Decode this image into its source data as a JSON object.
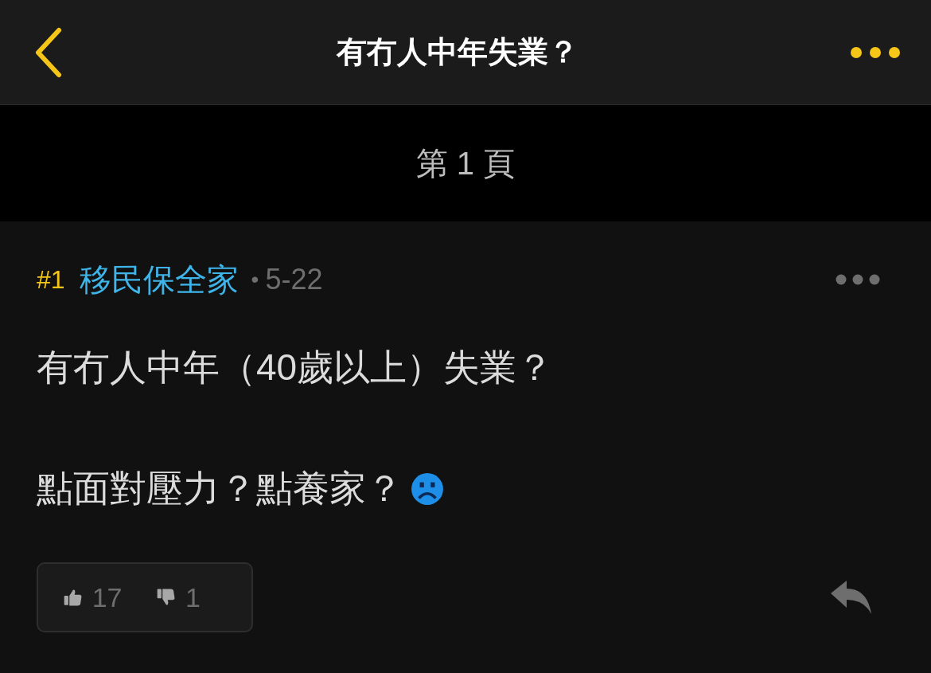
{
  "header": {
    "title": "有冇人中年失業？"
  },
  "page_label": "第 1 頁",
  "post": {
    "number": "#1",
    "author": "移民保全家",
    "separator": "•",
    "date": "5-22",
    "paragraphs": [
      {
        "text": "有冇人中年（40歲以上）失業？",
        "emoji": false
      },
      {
        "text": "點面對壓力？點養家？",
        "emoji": true
      }
    ],
    "likes": "17",
    "dislikes": "1"
  }
}
